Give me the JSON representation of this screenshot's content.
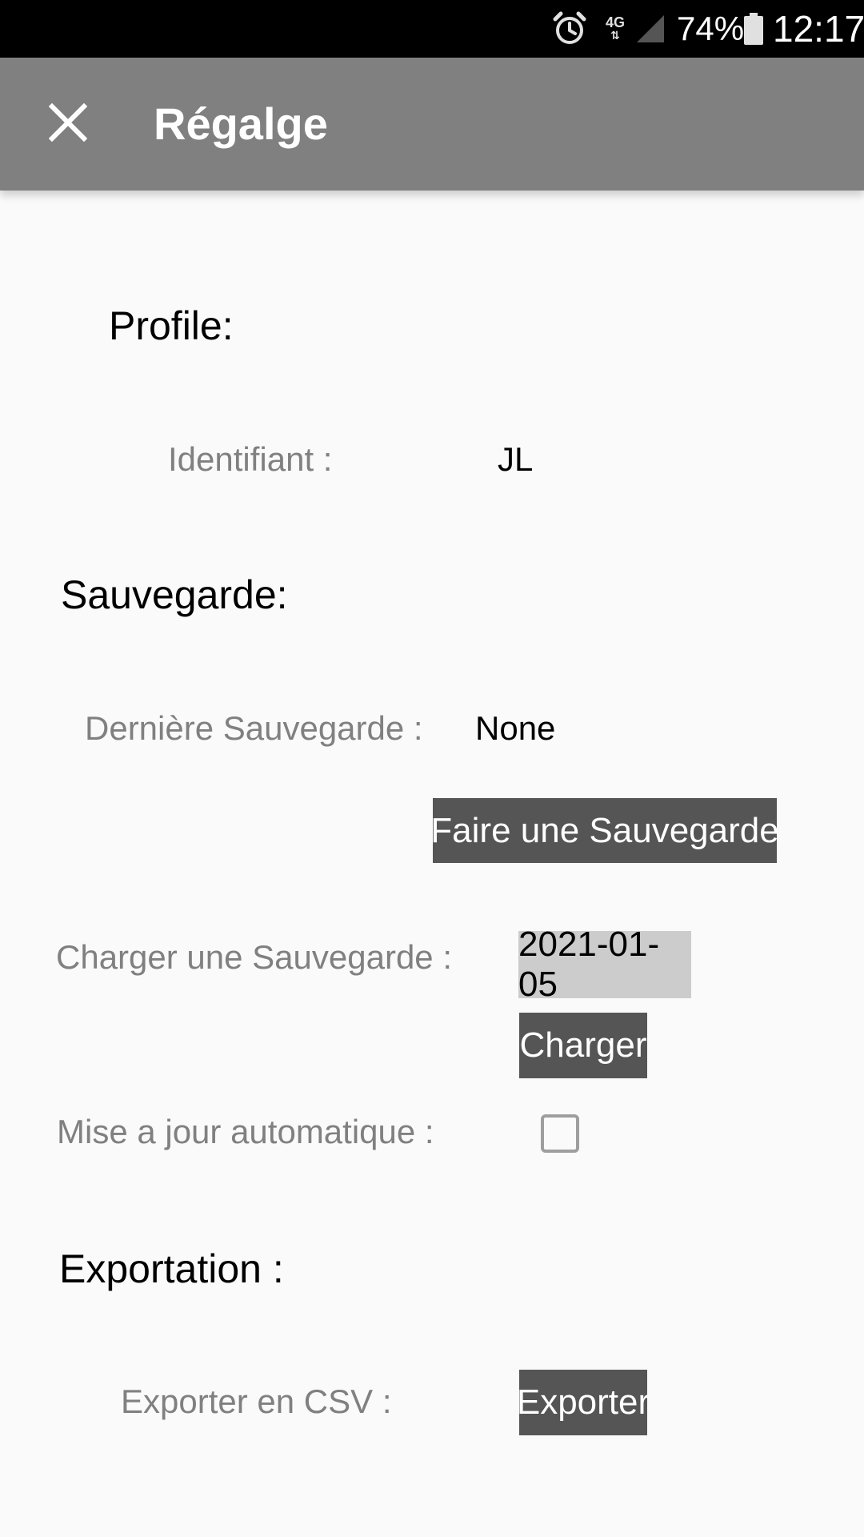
{
  "status_bar": {
    "network": "4G",
    "battery_percent": "74%",
    "time": "12:17",
    "icons": [
      "alarm-icon",
      "signal-icon",
      "battery-icon"
    ]
  },
  "app_bar": {
    "title": "Régalge",
    "close_icon": "close-icon",
    "background_color": "#808080"
  },
  "profile": {
    "section_title": "Profile:",
    "identifier_label": "Identifiant :",
    "identifier_value": "JL"
  },
  "backup": {
    "section_title": "Sauvegarde:",
    "last_backup_label": "Dernière Sauvegarde :",
    "last_backup_value": "None",
    "make_backup_button": "Faire une Sauvegarde",
    "load_backup_label": "Charger une Sauvegarde :",
    "load_backup_date": "2021-01-05",
    "load_button": "Charger",
    "auto_update_label": "Mise a jour automatique :",
    "auto_update_checked": false
  },
  "export": {
    "section_title": "Exportation :",
    "csv_label": "Exporter en CSV :",
    "export_button": "Exporter"
  },
  "colors": {
    "button_bg": "#555555",
    "date_field_bg": "#cccccc",
    "label_text": "#808080"
  }
}
